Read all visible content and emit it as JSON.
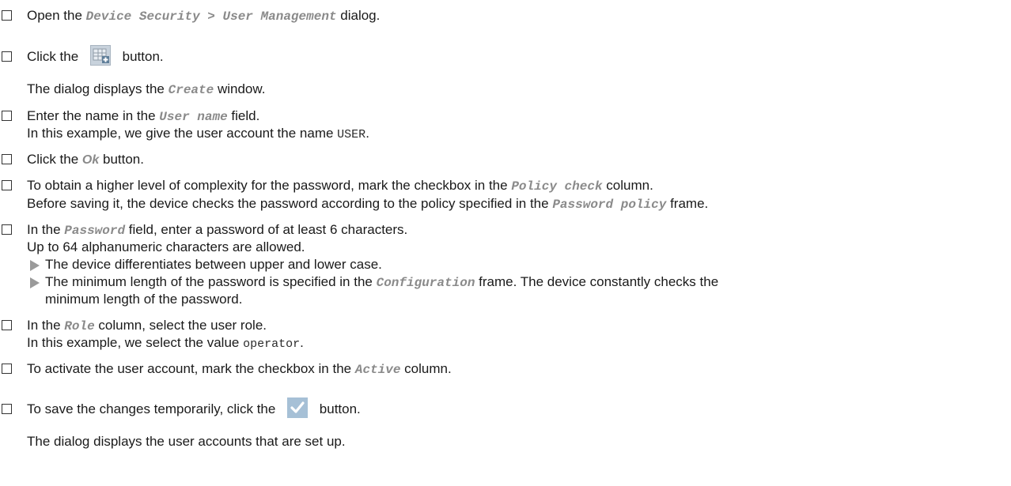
{
  "steps": [
    {
      "pre": "Open the ",
      "ui": "Device Security > User Management",
      "post": " dialog."
    },
    {
      "pre": "Click the ",
      "icon": "add-table-row-icon",
      "post": " button."
    },
    {
      "note": "The dialog displays the ",
      "ui": "Create",
      "post": " window."
    },
    {
      "pre": "Enter the name in the ",
      "ui": "User name",
      "post": " field.",
      "sub": "In this example, we give the user account the name ",
      "subcode": "USER",
      "subpost": "."
    },
    {
      "pre": "Click the ",
      "ui": "Ok",
      "post": " button."
    },
    {
      "pre": "To obtain a higher level of complexity for the password, mark the checkbox in the ",
      "ui": "Policy check",
      "post": " column.",
      "sub": "Before saving it, the device checks the password according to the policy specified in the ",
      "subui": "Password policy",
      "subpost": " frame."
    },
    {
      "pre": "In the ",
      "ui": "Password",
      "post": " field, enter a password of at least 6 characters.",
      "sub": "Up to 64 alphanumeric characters are allowed.",
      "bullets": [
        {
          "text": "The device differentiates between upper and lower case."
        },
        {
          "pre": "The minimum length of the password is specified in the ",
          "ui": "Configuration",
          "post": " frame. The device constantly checks the",
          "cont": "minimum length of the password."
        }
      ]
    },
    {
      "pre": "In the ",
      "ui": "Role",
      "post": " column, select the user role.",
      "sub": "In this example, we select the value ",
      "subcode": "operator",
      "subpost": "."
    },
    {
      "pre": "To activate the user account, mark the checkbox in the ",
      "ui": "Active",
      "post": " column."
    },
    {
      "pre": "To save the changes temporarily, click the ",
      "icon": "checkmark-icon",
      "post": " button.",
      "note2": "The dialog displays the user accounts that are set up."
    }
  ]
}
